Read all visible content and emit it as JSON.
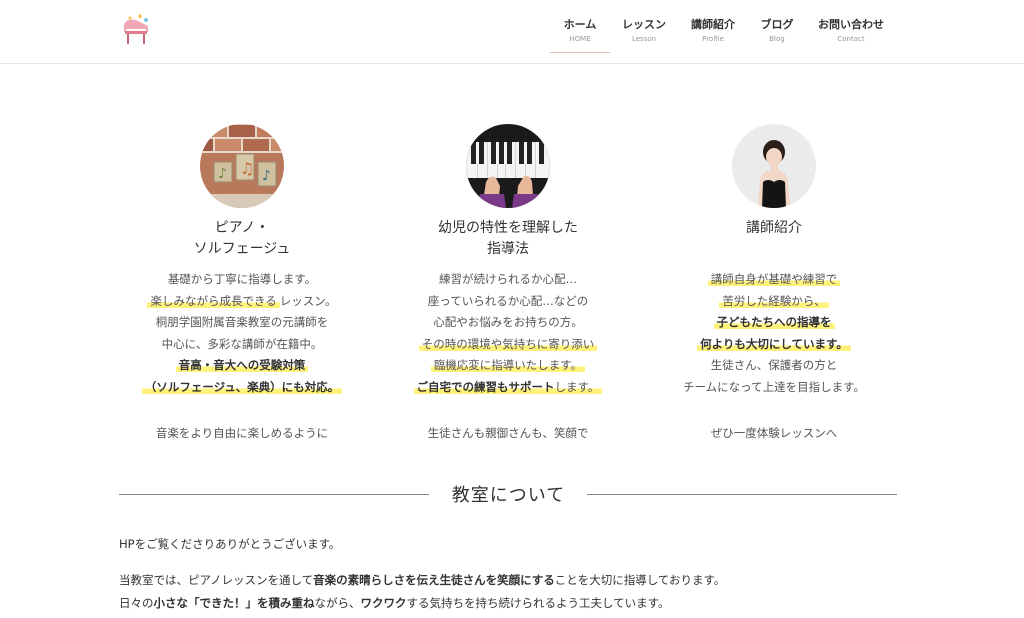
{
  "colors": {
    "accent_pink": "#f2b3b3",
    "highlight_yellow": "#fff27a"
  },
  "header": {
    "logo_icon": "piano-logo-icon",
    "nav": [
      {
        "label": "ホーム",
        "sub": "HOME",
        "active": true
      },
      {
        "label": "レッスン",
        "sub": "Lesson"
      },
      {
        "label": "講師紹介",
        "sub": "Profile"
      },
      {
        "label": "ブログ",
        "sub": "Blog"
      },
      {
        "label": "お問い合わせ",
        "sub": "Contact"
      }
    ]
  },
  "features": [
    {
      "image_icon": "music-notes-photo",
      "title_lines": [
        "ピアノ・",
        "ソルフェージュ"
      ],
      "body": {
        "l1": "基礎から丁寧に指導します。",
        "l2a": "楽しみながら成長できる",
        "l2b": "レッスン。",
        "l3": "桐朋学園附属音楽教室の元講師を",
        "l4": "中心に、多彩な講師が在籍中。",
        "l5": "音高・音大への受験対策",
        "l6": "（ソルフェージュ、楽典）にも対応。"
      },
      "footer": "音楽をより自由に楽しめるように"
    },
    {
      "image_icon": "piano-hands-photo",
      "title_lines": [
        "幼児の特性を理解した",
        "指導法"
      ],
      "body": {
        "l1": "練習が続けられるか心配…",
        "l2": "座っていられるか心配…などの",
        "l3": "心配やお悩みをお持ちの方。",
        "l4": "その時の環境や気持ちに寄り添い",
        "l5": "臨機応変に指導いたします。",
        "l6a": "ご自宅での練習もサポート",
        "l6b": "します。"
      },
      "footer": "生徒さんも親御さんも、笑顔で"
    },
    {
      "image_icon": "teacher-portrait-photo",
      "title_lines": [
        "講師紹介"
      ],
      "body": {
        "l1": "講師自身が基礎や練習で",
        "l2": "苦労した経験から、",
        "l3": "子どもたちへの指導を",
        "l4": "何よりも大切にしています。",
        "l5": "生徒さん、保護者の方と",
        "l6": "チームになって上達を目指します。"
      },
      "footer": "ぜひ一度体験レッスンへ"
    }
  ],
  "section": {
    "title": "教室について"
  },
  "about": {
    "p1": "HPをご覧くださりありがとうございます。",
    "p2a": "当教室では、ピアノレッスンを通して",
    "p2b": "音楽の素晴らしさを伝え生徒さんを笑顔にする",
    "p2c": "ことを大切に指導しております。",
    "p3a": "日々の",
    "p3b": "小さな「できた！」を積み重ね",
    "p3c": "ながら、",
    "p3d": "ワクワク",
    "p3e": "する気持ちを持ち続けられるよう工夫しています。"
  }
}
